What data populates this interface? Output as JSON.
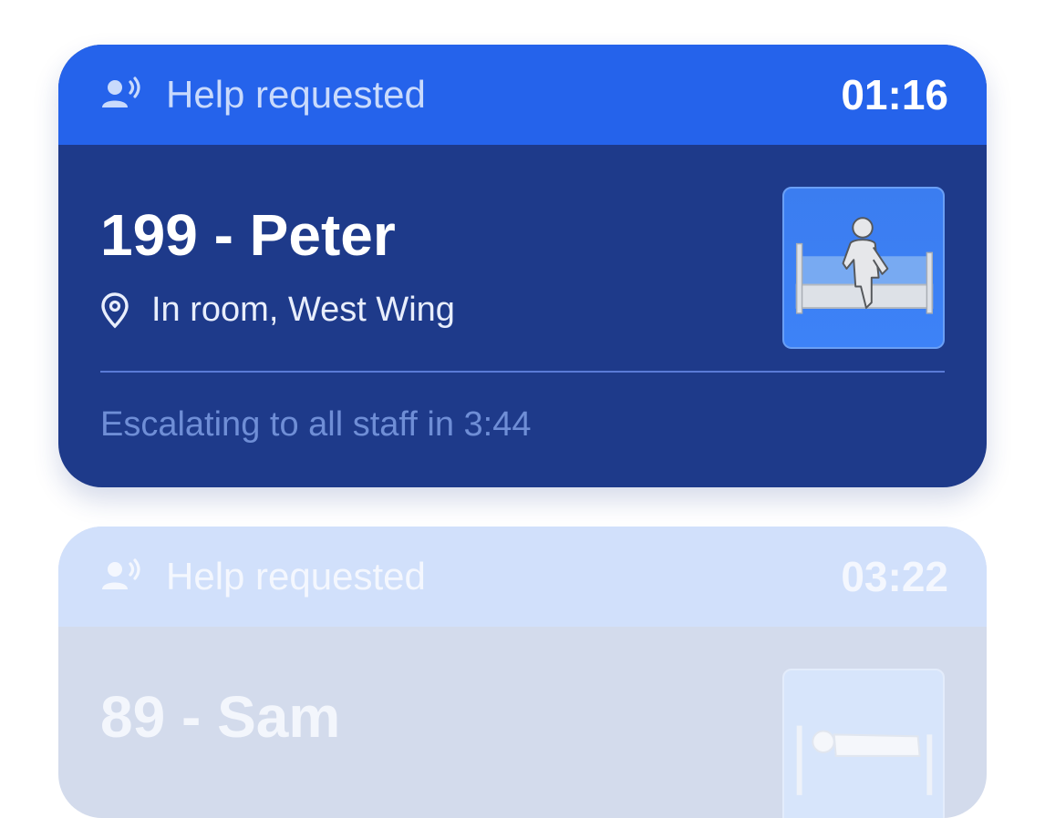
{
  "alerts": [
    {
      "title": "Help requested",
      "timer": "01:16",
      "patient": "199 - Peter",
      "location": "In room, West Wing",
      "escalation": "Escalating to all staff in 3:44",
      "status_icon": "person-speaking-icon",
      "thumbnail": "person-sitting-on-bed-edge"
    },
    {
      "title": "Help requested",
      "timer": "03:22",
      "patient": "89 - Sam",
      "status_icon": "person-speaking-icon",
      "thumbnail": "person-lying-in-bed"
    }
  ],
  "colors": {
    "header_active": "#2563eb",
    "body_active": "#1e3a8a",
    "header_faded": "#d1e0fb",
    "body_faded": "#d3dbec"
  }
}
